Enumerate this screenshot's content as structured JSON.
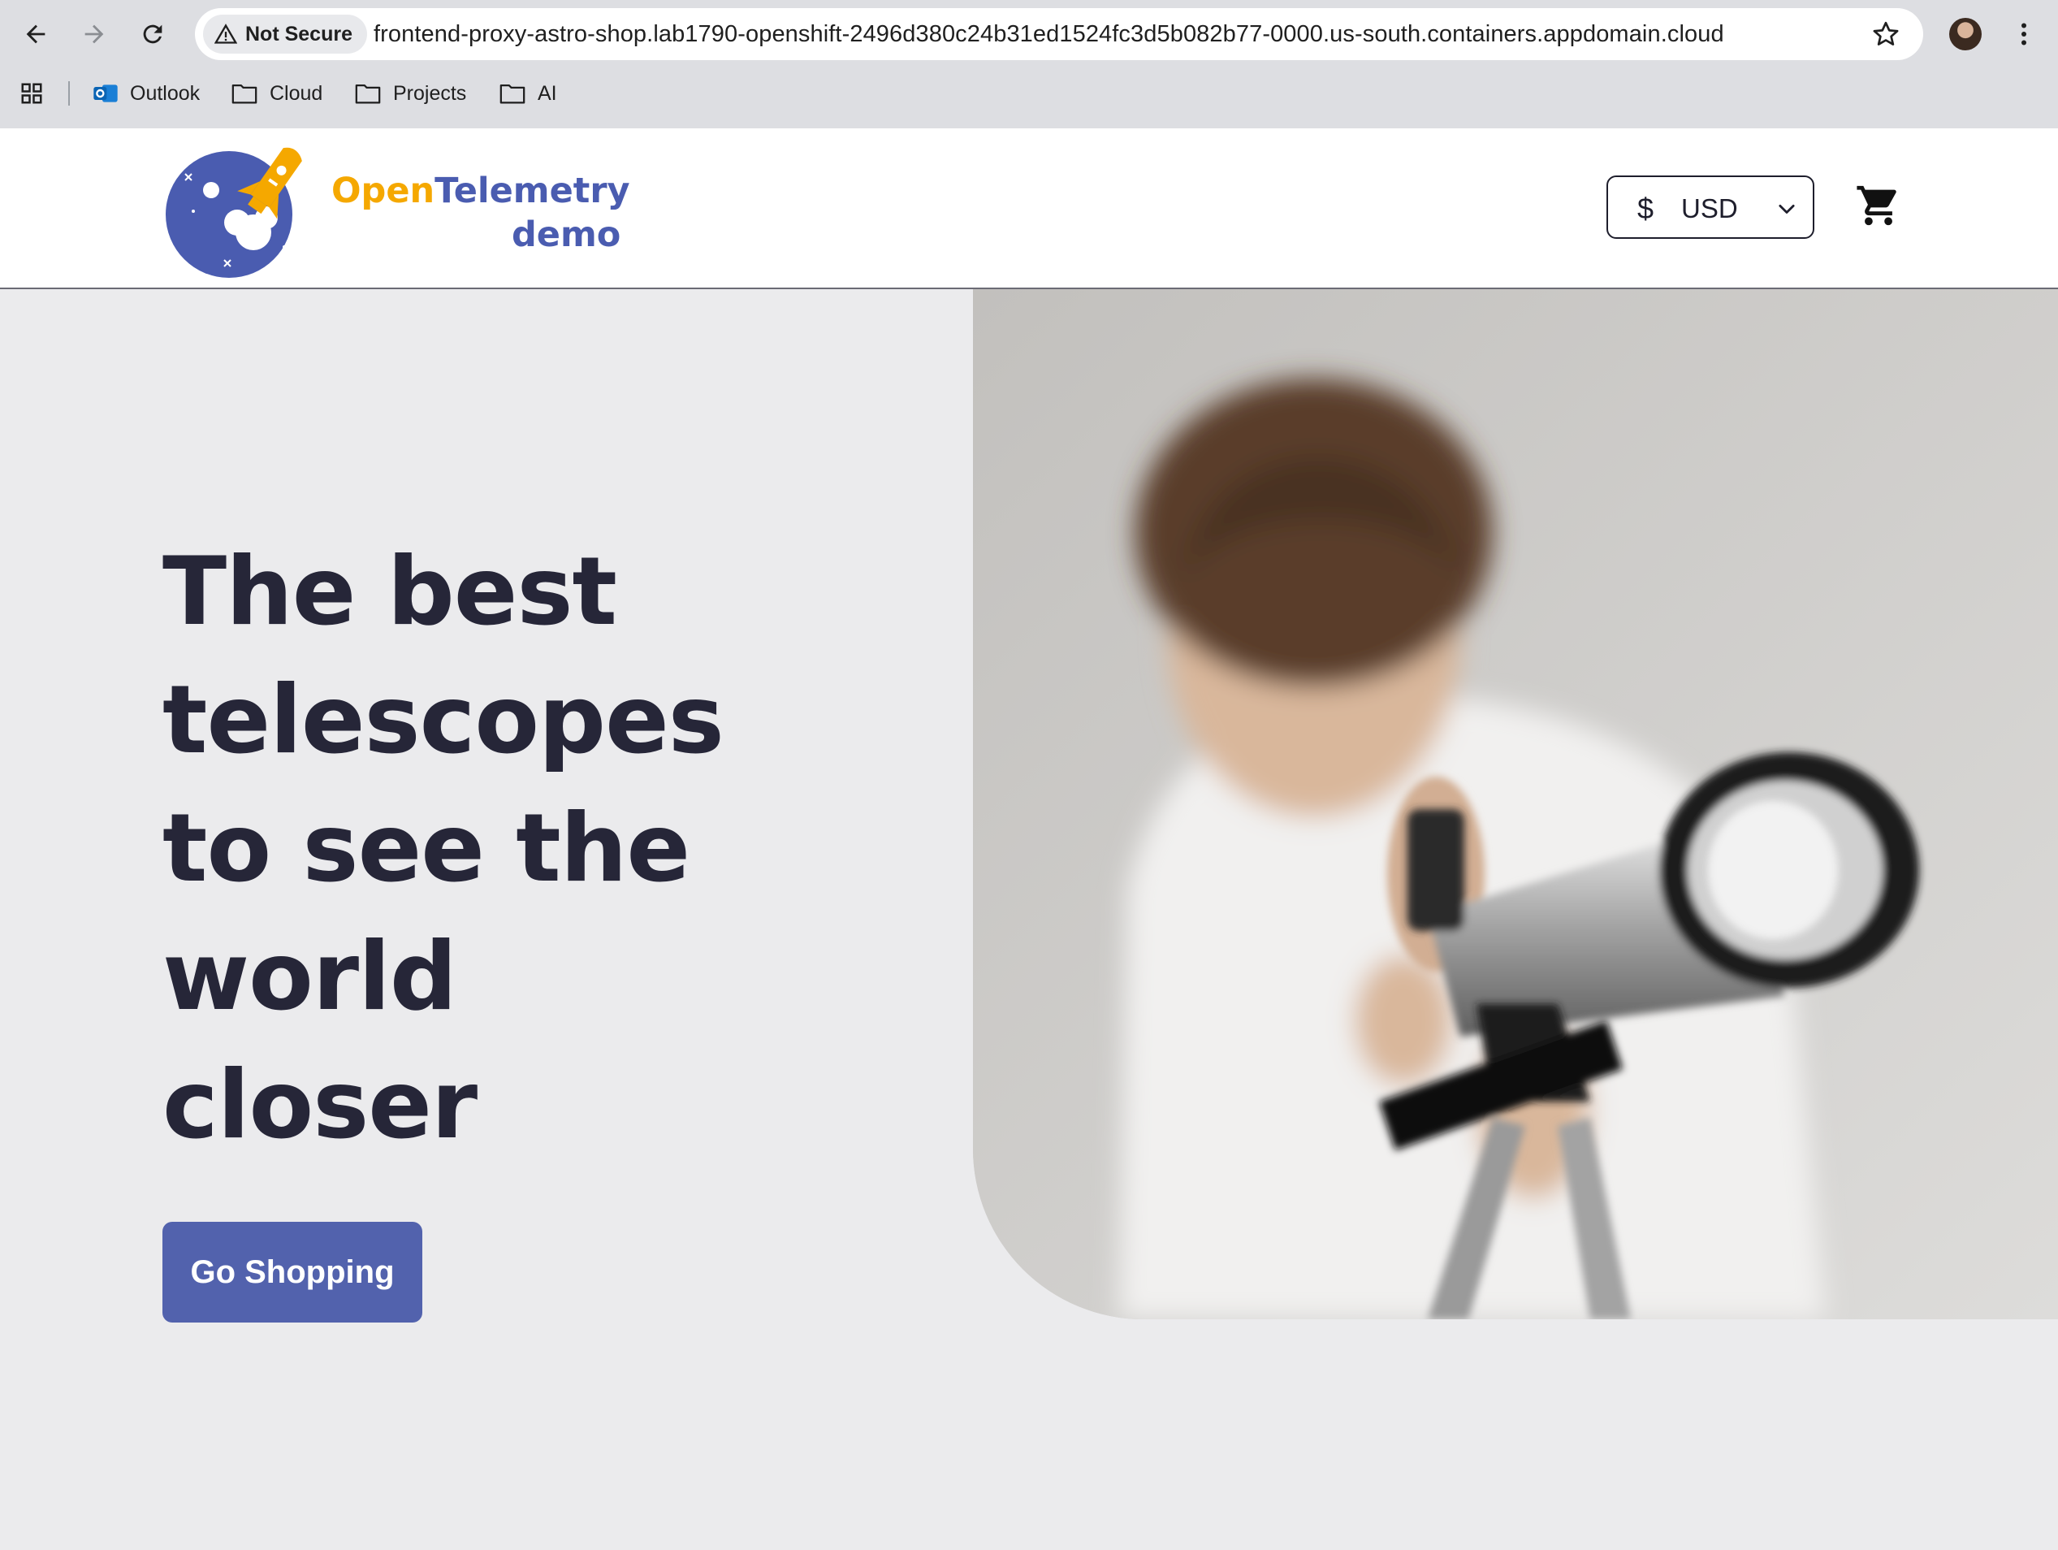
{
  "browser": {
    "security_label": "Not Secure",
    "url": "frontend-proxy-astro-shop.lab1790-openshift-2496d380c24b31ed1524fc3d5b082b77-0000.us-south.containers.appdomain.cloud",
    "bookmarks": [
      {
        "label": "Outlook",
        "icon": "outlook-icon"
      },
      {
        "label": "Cloud",
        "icon": "folder-icon"
      },
      {
        "label": "Projects",
        "icon": "folder-icon"
      },
      {
        "label": "AI",
        "icon": "folder-icon"
      }
    ]
  },
  "header": {
    "brand_part1": "Open",
    "brand_part2": "Telemetry",
    "brand_sub": "demo",
    "currency_symbol": "$",
    "currency_code": "USD"
  },
  "hero": {
    "title": "The best telescopes to see the world closer",
    "cta_label": "Go Shopping",
    "image_alt": "child-looking-through-telescope"
  },
  "colors": {
    "brand_orange": "#f5a800",
    "brand_blue": "#4a5cb0",
    "cta_bg": "#5262ad",
    "heading": "#262638",
    "page_bg": "#ebebed"
  }
}
